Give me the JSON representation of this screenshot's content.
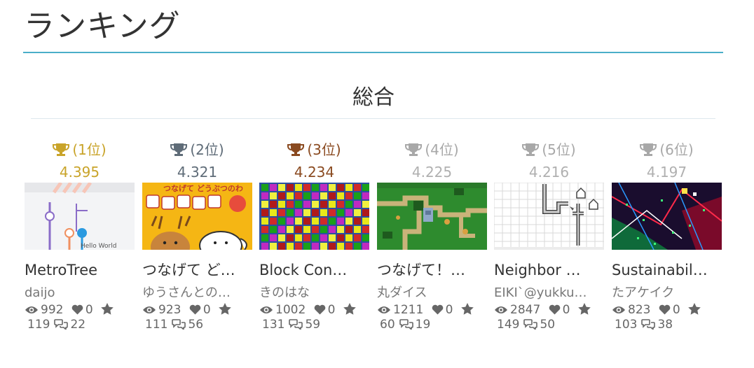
{
  "page": {
    "title": "ランキング"
  },
  "section": {
    "title": "総合"
  },
  "colors": {
    "accent_rule": "#4aaec8",
    "gold": "#c9a42a",
    "silver": "#5f6c78",
    "bronze": "#8a4a20",
    "other": "#a8a8a8"
  },
  "icons": {
    "rank": "trophy-icon",
    "views": "eye-icon",
    "likes": "heart-icon",
    "favorites": "star-icon",
    "comments": "comments-icon"
  },
  "ranking": [
    {
      "rank_label": "(1位)",
      "score": "4.395",
      "name": "MetroTree",
      "author": "daijo",
      "views": "992",
      "likes": "0",
      "favorites": "119",
      "comments": "22"
    },
    {
      "rank_label": "(2位)",
      "score": "4.321",
      "name": "つなげて ど…",
      "author": "ゆうさんとの…",
      "views": "923",
      "likes": "0",
      "favorites": "111",
      "comments": "56"
    },
    {
      "rank_label": "(3位)",
      "score": "4.234",
      "name": "Block Con…",
      "author": "きのはな",
      "views": "1002",
      "likes": "0",
      "favorites": "131",
      "comments": "59"
    },
    {
      "rank_label": "(4位)",
      "score": "4.225",
      "name": "つなげて！…",
      "author": "丸ダイス",
      "views": "1211",
      "likes": "0",
      "favorites": "60",
      "comments": "19"
    },
    {
      "rank_label": "(5位)",
      "score": "4.216",
      "name": "Neighbor …",
      "author": "EIKI`@yukku…",
      "views": "2847",
      "likes": "0",
      "favorites": "149",
      "comments": "50"
    },
    {
      "rank_label": "(6位)",
      "score": "4.197",
      "name": "Sustainabil…",
      "author": "たアケイク",
      "views": "823",
      "likes": "0",
      "favorites": "103",
      "comments": "38"
    }
  ],
  "thumb_texts": {
    "metro_label": "Hello World",
    "tsunagete_title": "つなげて どうぶつのわ"
  }
}
